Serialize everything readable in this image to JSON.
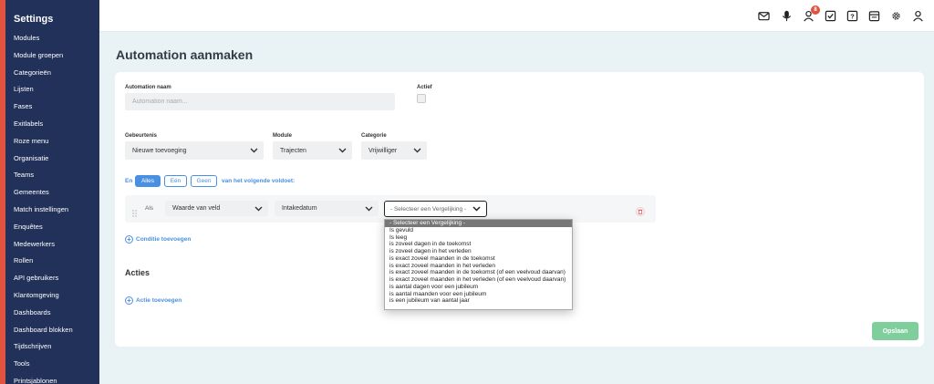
{
  "sidebar": {
    "title": "Settings",
    "items": [
      "Modules",
      "Module groepen",
      "Categorieën",
      "Lijsten",
      "Fases",
      "Exitlabels",
      "Roze menu",
      "Organisatie",
      "Teams",
      "Gemeentes",
      "Match instellingen",
      "Enquêtes",
      "Medewerkers",
      "Rollen",
      "API gebruikers",
      "Klantomgeving",
      "Dashboards",
      "Dashboard blokken",
      "Tijdschrijven",
      "Tools",
      "Printsjablonen"
    ]
  },
  "topbar": {
    "icons": [
      "mail-icon",
      "microphone-icon",
      "user-icon",
      "checkbox-icon",
      "help-icon",
      "calendar-icon",
      "gear-icon",
      "profile-icon"
    ],
    "user_badge": "8"
  },
  "page": {
    "title": "Automation aanmaken"
  },
  "form": {
    "name_label": "Automation naam",
    "name_placeholder": "Automation naam...",
    "active_label": "Actief",
    "event_label": "Gebeurtenis",
    "event_value": "Nieuwe toevoeging",
    "module_label": "Module",
    "module_value": "Trajecten",
    "category_label": "Categorie",
    "category_value": "Vrijwilliger"
  },
  "match": {
    "prefix": "En",
    "options": [
      "Alles",
      "Eén",
      "Geen"
    ],
    "selected": "Alles",
    "suffix": "van het volgende voldoet:"
  },
  "condition": {
    "als_label": "Als",
    "field_type": "Waarde van veld",
    "field": "Intakedatum",
    "comparison_placeholder": "- Selecteer een Vergelijking -"
  },
  "comparison_options": [
    "- Selecteer een Vergelijking -",
    "Is gevuld",
    "Is leeg",
    "is zoveel dagen in de toekomst",
    "is zoveel dagen in het verleden",
    "is exact zoveel maanden in de toekomst",
    "is exact zoveel maanden in het verleden",
    "is exact zoveel maanden in de toekomst (of een veelvoud daarvan)",
    "is exact zoveel maanden in het verleden (of een veelvoud daarvan)",
    "is aantal dagen voor een jubileum",
    "is aantal maanden voor een jubileum",
    "is een jubileum van aantal jaar"
  ],
  "actions": {
    "add_condition": "Conditie toevoegen",
    "section_title": "Acties",
    "add_action": "Actie toevoegen",
    "save": "Opslaan"
  },
  "colors": {
    "sidebar_bg": "#22315a",
    "accent_red": "#e0533f",
    "primary_blue": "#4a90e2",
    "save_green": "#7fcf9d"
  }
}
